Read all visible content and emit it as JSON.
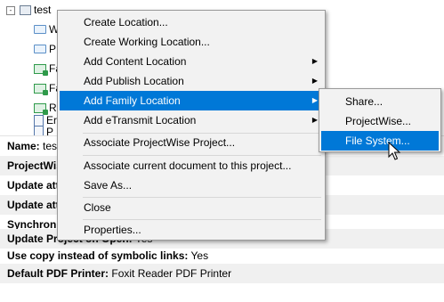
{
  "tree": {
    "root_label": "test",
    "expander": "-",
    "children": [
      "W",
      "P",
      "Fa",
      "Fa",
      "Re",
      "Er",
      "P"
    ]
  },
  "properties": [
    {
      "label": "Name:",
      "value": "test"
    },
    {
      "label": "ProjectWis",
      "value": ""
    },
    {
      "label": "Update att",
      "value": ""
    },
    {
      "label": "Update att",
      "value": ""
    },
    {
      "label": "Synchroniz",
      "value": ""
    },
    {
      "label": "Update Project on Open:",
      "value": "Yes"
    },
    {
      "label": "Use copy instead of symbolic links:",
      "value": "Yes"
    },
    {
      "label": "Default PDF Printer:",
      "value": "Foxit Reader PDF Printer"
    }
  ],
  "context_menu": {
    "items": [
      {
        "label": "Create Location...",
        "submenu": false
      },
      {
        "label": "Create Working Location...",
        "submenu": false
      },
      {
        "label": "Add Content Location",
        "submenu": true
      },
      {
        "label": "Add Publish Location",
        "submenu": true
      },
      {
        "label": "Add Family Location",
        "submenu": true,
        "highlighted": true
      },
      {
        "label": "Add eTransmit Location",
        "submenu": true
      },
      {
        "label": "Associate ProjectWise Project...",
        "submenu": false
      },
      {
        "label": "Associate current document to this project...",
        "submenu": false
      },
      {
        "label": "Save As...",
        "submenu": false
      },
      {
        "label": "Close",
        "submenu": false
      },
      {
        "label": "Properties...",
        "submenu": false
      }
    ],
    "submenu_arrow": "▶"
  },
  "submenu": {
    "items": [
      {
        "label": "Share..."
      },
      {
        "label": "ProjectWise..."
      },
      {
        "label": "File System...",
        "highlighted": true
      }
    ]
  },
  "colors": {
    "highlight": "#0078d7",
    "menu_bg": "#f2f2f2",
    "alt_row": "#f0f0f0"
  }
}
